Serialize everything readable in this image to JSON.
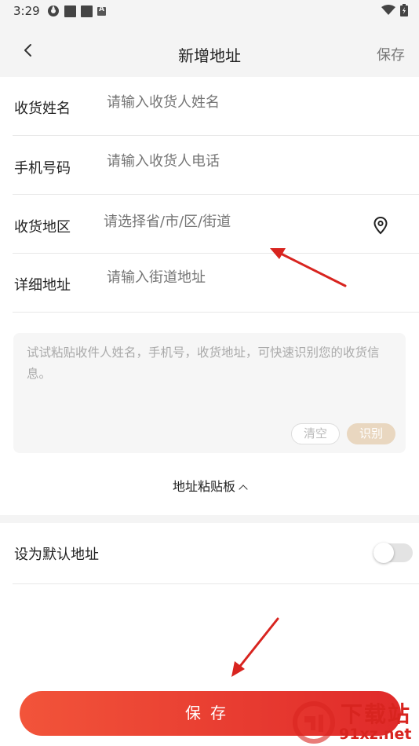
{
  "status_bar": {
    "time": "3:29",
    "icons": [
      "sync-icon",
      "notification-square-icon",
      "notification-square-icon",
      "app-a-icon",
      "wifi-icon",
      "battery-icon"
    ],
    "badge_letter": "A"
  },
  "nav": {
    "title": "新增地址",
    "save_label": "保存",
    "back_icon": "chevron-left-icon"
  },
  "form": {
    "name": {
      "label": "收货姓名",
      "placeholder": "请输入收货人姓名"
    },
    "phone": {
      "label": "手机号码",
      "placeholder": "请输入收货人电话"
    },
    "region": {
      "label": "收货地区",
      "placeholder": "请选择省/市/区/街道",
      "icon": "location-pin-icon"
    },
    "detail": {
      "label": "详细地址",
      "placeholder": "请输入街道地址"
    }
  },
  "paste": {
    "placeholder": "试试粘贴收件人姓名，手机号，收货地址，可快速识别您的收货信息。",
    "clear_label": "清空",
    "recognize_label": "识别"
  },
  "clipboard_toggle_label": "地址粘贴板",
  "default_address": {
    "label": "设为默认地址",
    "enabled": false
  },
  "save_button_label": "保存",
  "watermark": {
    "title": "下载站",
    "domain": "91xz.net"
  },
  "colors": {
    "accent_red": "#e02a2a",
    "accent_orange": "#f2543a",
    "recognize_beige": "#e9d7c0",
    "placeholder_gray": "#aaaaaa",
    "background_gray": "#f4f4f4"
  }
}
